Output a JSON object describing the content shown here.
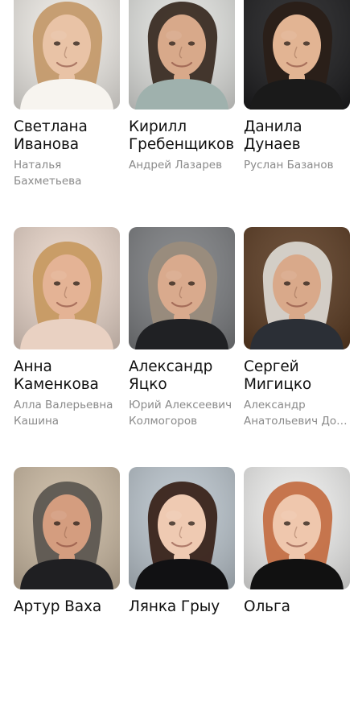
{
  "cast": [
    {
      "name": "Светлана\nИванова",
      "role_lines": [
        "Наталья",
        "Бахметьева"
      ],
      "icon": "actor-photo",
      "palette": {
        "bg": "#ece9e4",
        "skin": "#e9c3a6",
        "hair": "#c49a6c",
        "cloth": "#f7f4ef"
      }
    },
    {
      "name": "Кирилл\nГребенщиков",
      "role_lines": [
        "Андрей Лазарев"
      ],
      "icon": "actor-photo",
      "palette": {
        "bg": "#dfe0dd",
        "skin": "#d8a98a",
        "hair": "#3b2d24",
        "cloth": "#9fb1ad"
      }
    },
    {
      "name": "Данила\nДунаев",
      "role_lines": [
        "Руслан Базанов"
      ],
      "icon": "actor-photo",
      "palette": {
        "bg": "#1c1c1e",
        "skin": "#e2b493",
        "hair": "#2a1f18",
        "cloth": "#1a1a1a"
      }
    },
    {
      "name": "Анна\nКаменкова",
      "role_lines": [
        "Алла Валерьевна",
        "Кашина"
      ],
      "icon": "actor-photo",
      "palette": {
        "bg": "#e7d4c8",
        "skin": "#e4b395",
        "hair": "#c79a62",
        "cloth": "#e9d1c2"
      }
    },
    {
      "name": "Александр\nЯцко",
      "role_lines": [
        "Юрий Алексеевич",
        "Колмогоров"
      ],
      "icon": "actor-photo",
      "palette": {
        "bg": "#7b7d80",
        "skin": "#d9aa8d",
        "hair": "#9a8c7c",
        "cloth": "#202124"
      }
    },
    {
      "name": "Сергей\nМигицко",
      "role_lines": [
        "Александр",
        "Анатольевич До…"
      ],
      "icon": "actor-photo",
      "palette": {
        "bg": "#5b3b22",
        "skin": "#d9a98a",
        "hair": "#d9d5cf",
        "cloth": "#2b2f36"
      }
    },
    {
      "name": "Артур Ваха",
      "role_lines": [],
      "icon": "actor-photo",
      "palette": {
        "bg": "#c9b8a1",
        "skin": "#d49d7f",
        "hair": "#5d5751",
        "cloth": "#1f1f22"
      }
    },
    {
      "name": "Лянка Грыу",
      "role_lines": [],
      "icon": "actor-photo",
      "palette": {
        "bg": "#b9c3cb",
        "skin": "#efcab2",
        "hair": "#3a241b",
        "cloth": "#111113"
      }
    },
    {
      "name": "Ольга",
      "role_lines": [],
      "icon": "actor-photo",
      "palette": {
        "bg": "#ececeb",
        "skin": "#efc7ad",
        "hair": "#c46f44",
        "cloth": "#111111"
      }
    }
  ]
}
